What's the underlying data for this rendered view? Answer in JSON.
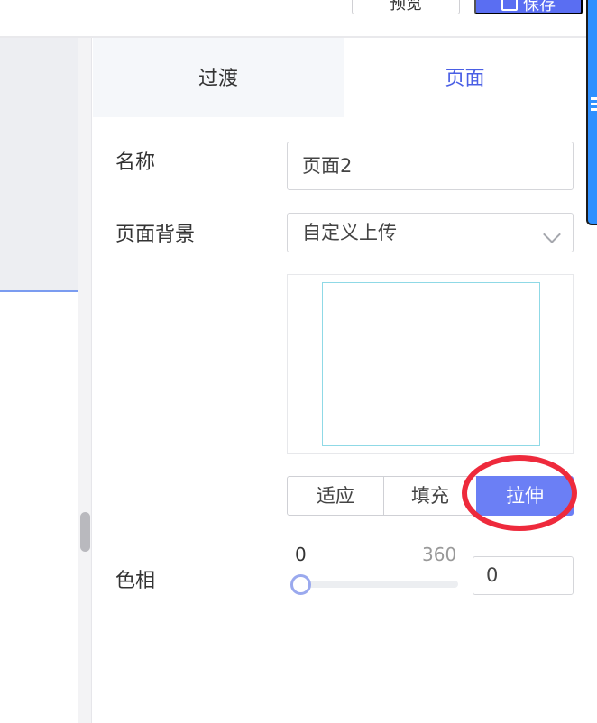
{
  "toolbar": {
    "preview_label": "预览",
    "save_label": "保存"
  },
  "tabs": [
    {
      "label": "过渡",
      "active": false
    },
    {
      "label": "页面",
      "active": true
    }
  ],
  "form": {
    "name_label": "名称",
    "name_value": "页面2",
    "background_label": "页面背景",
    "background_value": "自定义上传",
    "fit_options": [
      {
        "label": "适应",
        "selected": false
      },
      {
        "label": "填充",
        "selected": false
      },
      {
        "label": "拉伸",
        "selected": true
      }
    ],
    "hue_label": "色相",
    "hue_min": "0",
    "hue_max": "360",
    "hue_value": "0",
    "hue_level": 0
  },
  "colors": {
    "accent": "#4a5fe5",
    "selected_segment": "#6b7ff5",
    "annotation": "#ee2a3c"
  },
  "icons": {
    "save": "save-icon",
    "dropdown": "chevron-down-icon"
  }
}
